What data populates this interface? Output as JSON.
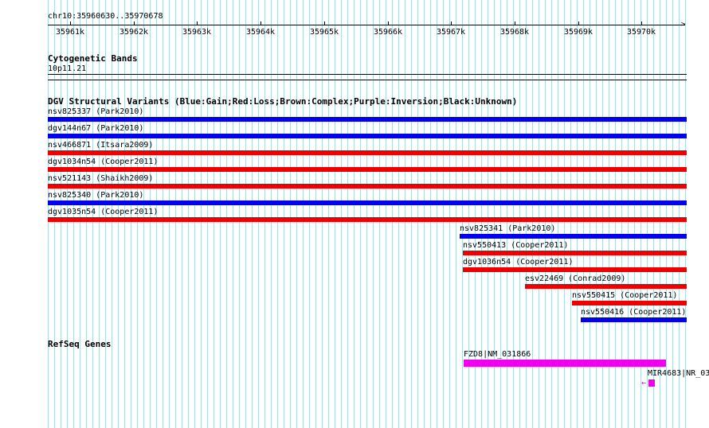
{
  "ruler": {
    "location": "chr10:35960630..35970678",
    "ticks": [
      "35961k",
      "35962k",
      "35963k",
      "35964k",
      "35965k",
      "35966k",
      "35967k",
      "35968k",
      "35969k",
      "35970k"
    ]
  },
  "cytoband": {
    "title": "Cytogenetic Bands",
    "band": "10p11.21"
  },
  "dgv": {
    "title": "DGV Structural Variants (Blue:Gain;Red:Loss;Brown:Complex;Purple:Inversion;Black:Unknown)",
    "variants": [
      {
        "label": "nsv825337 (Park2010)",
        "color": "#0000ee"
      },
      {
        "label": "dgv144n67 (Park2010)",
        "color": "#0000ee"
      },
      {
        "label": "nsv466871 (Itsara2009)",
        "color": "#ee0000"
      },
      {
        "label": "dgv1034n54 (Cooper2011)",
        "color": "#ee0000"
      },
      {
        "label": "nsv521143 (Shaikh2009)",
        "color": "#ee0000"
      },
      {
        "label": "nsv825340 (Park2010)",
        "color": "#0000ee"
      },
      {
        "label": "dgv1035n54 (Cooper2011)",
        "color": "#ee0000"
      },
      {
        "label": "nsv825341 (Park2010)",
        "color": "#0000ee"
      },
      {
        "label": "nsv550413 (Cooper2011)",
        "color": "#ee0000"
      },
      {
        "label": "dgv1036n54 (Cooper2011)",
        "color": "#ee0000"
      },
      {
        "label": "esv22469 (Conrad2009)",
        "color": "#ee0000"
      },
      {
        "label": "nsv550415 (Cooper2011)",
        "color": "#ee0000"
      },
      {
        "label": "nsv550416 (Cooper2011)",
        "color": "#0000ee"
      }
    ]
  },
  "refseq": {
    "title": "RefSeq Genes",
    "genes": [
      {
        "label": "FZD8|NM_031866",
        "color": "#ee00ee"
      },
      {
        "label": "MIR4683|NR_03",
        "color": "#ee00ee",
        "strand_arrow": "←"
      }
    ]
  },
  "colors": {
    "gain": "#0000ee",
    "loss": "#ee0000",
    "gene": "#ee00ee",
    "grid": "#add8e6"
  }
}
